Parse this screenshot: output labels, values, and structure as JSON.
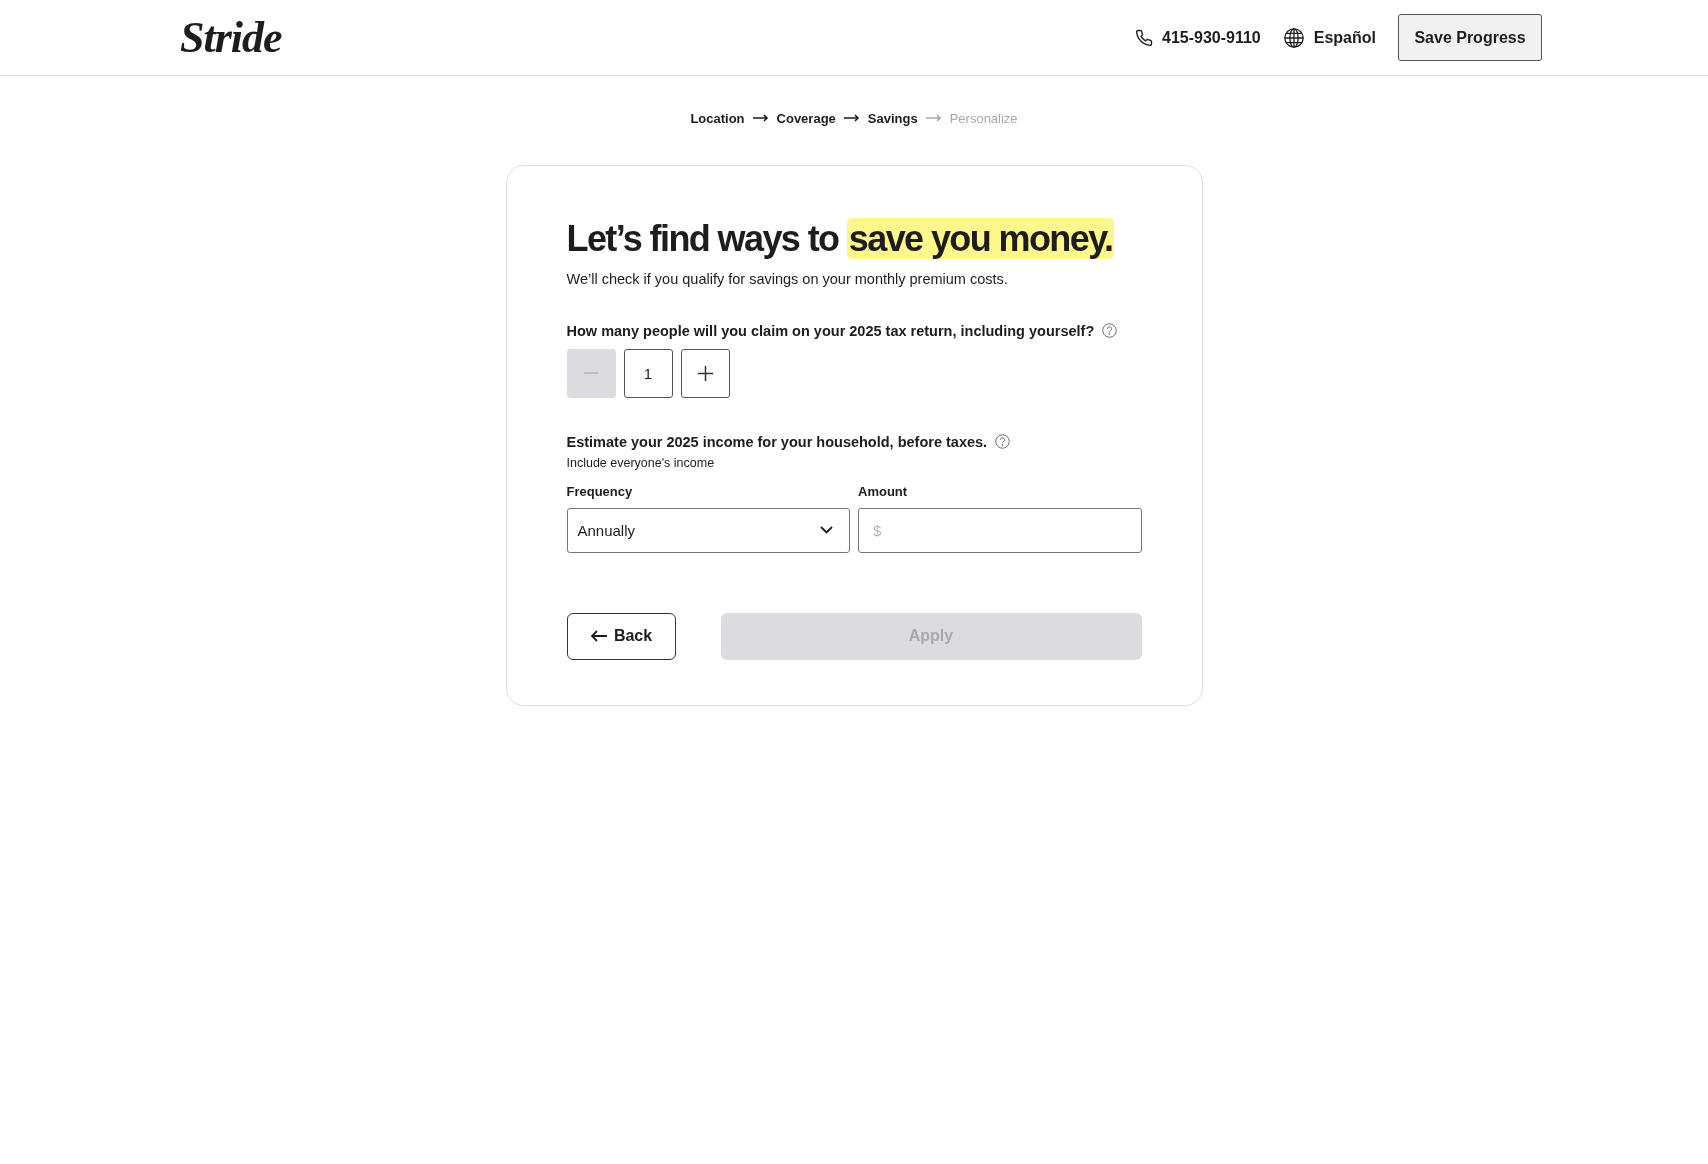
{
  "header": {
    "logo": "Stride",
    "phone": "415-930-9110",
    "language": "Español",
    "save_button": "Save Progress"
  },
  "steps": [
    {
      "label": "Location",
      "completed": true
    },
    {
      "label": "Coverage",
      "completed": true
    },
    {
      "label": "Savings",
      "completed": true
    },
    {
      "label": "Personalize",
      "completed": false
    }
  ],
  "card": {
    "heading": "Let’s find ways to",
    "heading_highlight": "save you money.",
    "subtitle": "We’ll check if you qualify for savings on your monthly premium costs.",
    "people_question": "How many people will you claim on your 2025 tax return, including yourself?",
    "stepper": {
      "value": "1",
      "decrement_disabled": true
    },
    "income_question": "Estimate your 2025 income for your household, before taxes.",
    "income_hint": "Include everyone's income",
    "frequency": {
      "label": "Frequency",
      "value": "Annually"
    },
    "amount": {
      "label": "Amount",
      "placeholder": "$"
    },
    "back_button": "Back",
    "apply_button": {
      "label": "Apply",
      "disabled": true
    }
  }
}
